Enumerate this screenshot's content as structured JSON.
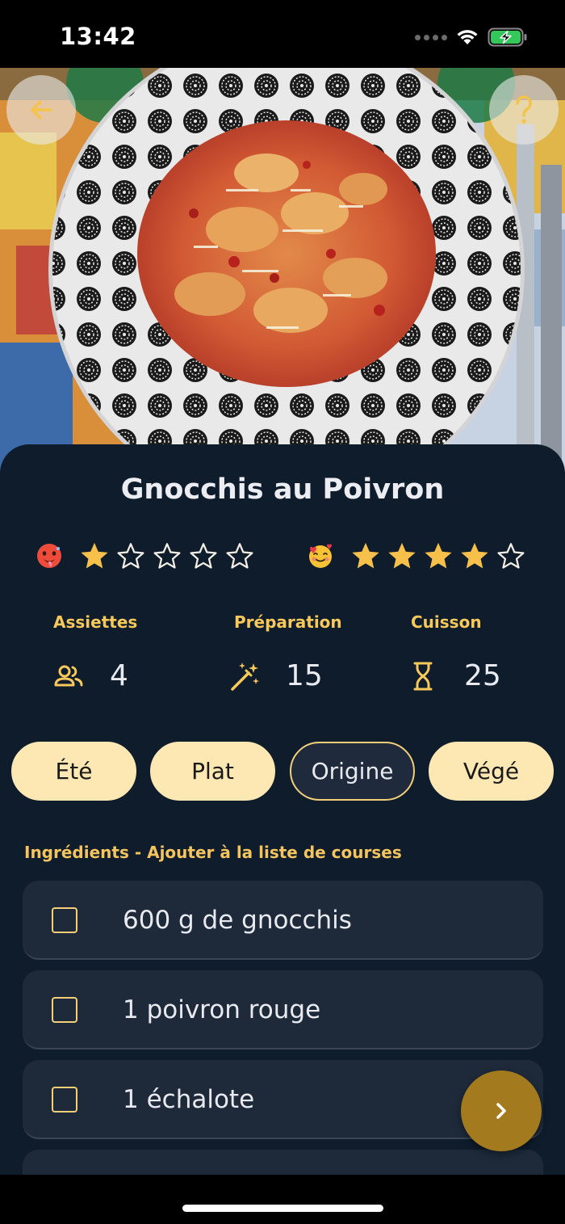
{
  "status_bar": {
    "time": "13:42",
    "signal_icon": "signal-dots-icon",
    "wifi_icon": "wifi-icon",
    "battery_icon": "battery-charging-icon",
    "battery_color": "#34c759"
  },
  "header": {
    "back_icon": "arrow-left-icon",
    "help_icon": "question-mark-icon",
    "icon_color": "#f3c34a"
  },
  "recipe": {
    "title": "Gnocchis au Poivron",
    "ratings": [
      {
        "emoji_icon": "hot-face-emoji-icon",
        "value": 1,
        "max": 5
      },
      {
        "emoji_icon": "smiling-face-with-hearts-emoji-icon",
        "value": 4,
        "max": 5
      }
    ],
    "meta": {
      "servings": {
        "label": "Assiettes",
        "icon": "people-icon",
        "value": "4"
      },
      "preparation": {
        "label": "Préparation",
        "icon": "magic-wand-icon",
        "value": "15"
      },
      "cooking": {
        "label": "Cuisson",
        "icon": "hourglass-icon",
        "value": "25"
      }
    },
    "tags": [
      {
        "label": "Été",
        "selected": true
      },
      {
        "label": "Plat",
        "selected": true
      },
      {
        "label": "Origine",
        "selected": false
      },
      {
        "label": "Végé",
        "selected": true
      }
    ],
    "ingredients_title": "Ingrédients - Ajouter à la liste de courses",
    "ingredients": [
      {
        "label": "600 g de gnocchis",
        "checked": false
      },
      {
        "label": "1 poivron rouge",
        "checked": false
      },
      {
        "label": "1 échalote",
        "checked": false
      }
    ]
  },
  "fab": {
    "icon": "chevron-right-icon"
  },
  "colors": {
    "accent": "#f4c55e",
    "sheet_bg": "#0e1c2c",
    "card_bg": "#1e2a3a",
    "tag_bg": "#fde8b4",
    "fab_bg": "#a47a1f"
  }
}
